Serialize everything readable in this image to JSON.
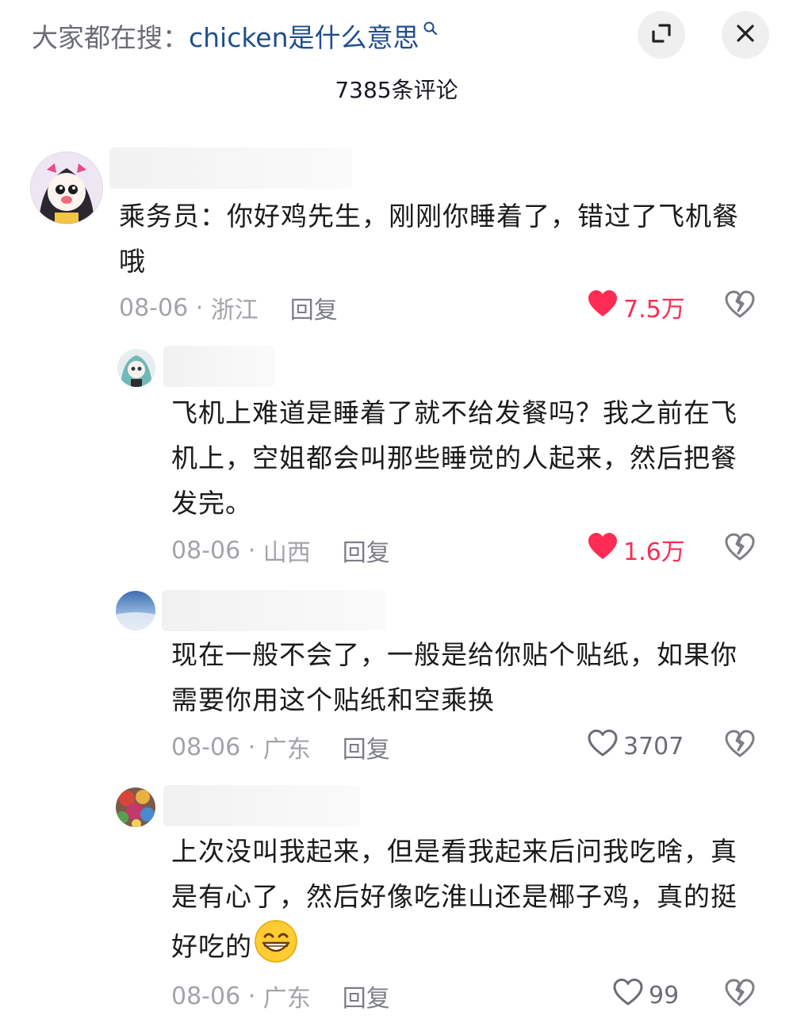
{
  "header": {
    "search_prefix": "大家都在搜：",
    "search_query": "chicken是什么意思",
    "comment_count": "7385条评论"
  },
  "comments": [
    {
      "text": "乘务员：你好鸡先生，刚刚你睡着了，错过了飞机餐哦",
      "date": "08-06",
      "location": "浙江",
      "reply_label": "回复",
      "likes": "7.5万",
      "liked": true
    },
    {
      "text": "飞机上难道是睡着了就不给发餐吗？我之前在飞机上，空姐都会叫那些睡觉的人起来，然后把餐发完。",
      "date": "08-06",
      "location": "山西",
      "reply_label": "回复",
      "likes": "1.6万",
      "liked": true
    },
    {
      "text": "现在一般不会了，一般是给你贴个贴纸，如果你需要你用这个贴纸和空乘换",
      "date": "08-06",
      "location": "广东",
      "reply_label": "回复",
      "likes": "3707",
      "liked": false
    },
    {
      "text": "上次没叫我起来，但是看我起来后问我吃啥，真是有心了，然后好像吃淮山还是椰子鸡，真的挺好吃的",
      "date": "08-06",
      "location": "广东",
      "reply_label": "回复",
      "likes": "99",
      "liked": false
    }
  ],
  "colors": {
    "accent_like": "#fe2c55",
    "query_blue": "#1f4e8c",
    "meta_gray": "#a3a4a9"
  },
  "icons": [
    "search-icon",
    "expand-icon",
    "close-icon",
    "heart-icon",
    "broken-heart-icon",
    "grin-emoji"
  ]
}
